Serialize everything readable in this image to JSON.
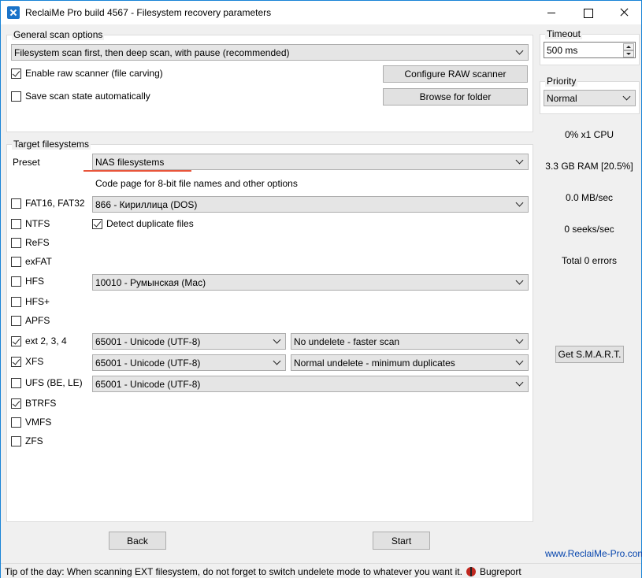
{
  "window": {
    "title": "ReclaiMe Pro build 4567 - Filesystem recovery parameters"
  },
  "general": {
    "title": "General scan options",
    "scan_mode": "Filesystem scan first, then deep scan, with pause (recommended)",
    "raw_scanner": {
      "label": "Enable raw scanner (file carving)",
      "checked": true
    },
    "save_state": {
      "label": "Save scan state automatically",
      "checked": false
    },
    "configure_raw_button": "Configure RAW scanner",
    "browse_button": "Browse for folder"
  },
  "target": {
    "title": "Target filesystems",
    "preset_label": "Preset",
    "preset_value": "NAS filesystems",
    "codepage_note": "Code page for 8-bit file names and other options",
    "detect_duplicates": {
      "label": "Detect duplicate files",
      "checked": true
    },
    "filesystems": [
      {
        "label": "FAT16, FAT32",
        "checked": false,
        "codepage": "866 - Кириллица (DOS)"
      },
      {
        "label": "NTFS",
        "checked": false
      },
      {
        "label": "ReFS",
        "checked": false
      },
      {
        "label": "exFAT",
        "checked": false
      },
      {
        "label": "HFS",
        "checked": false,
        "codepage": "10010 - Румынская (Mac)"
      },
      {
        "label": "HFS+",
        "checked": false
      },
      {
        "label": "APFS",
        "checked": false
      },
      {
        "label": "ext 2, 3, 4",
        "checked": true,
        "codepage": "65001 - Unicode (UTF-8)",
        "undelete": "No undelete - faster scan"
      },
      {
        "label": "XFS",
        "checked": true,
        "codepage": "65001 - Unicode (UTF-8)",
        "undelete": "Normal undelete - minimum duplicates"
      },
      {
        "label": "UFS (BE, LE)",
        "checked": false,
        "codepage": "65001 - Unicode (UTF-8)"
      },
      {
        "label": "BTRFS",
        "checked": true
      },
      {
        "label": "VMFS",
        "checked": false
      },
      {
        "label": "ZFS",
        "checked": false
      }
    ]
  },
  "buttons": {
    "back": "Back",
    "start": "Start"
  },
  "right_panel": {
    "timeout_label": "Timeout",
    "timeout_value": "500 ms",
    "priority_label": "Priority",
    "priority_value": "Normal",
    "cpu": "0% x1 CPU",
    "ram": "3.3 GB RAM [20.5%]",
    "speed": "0.0 MB/sec",
    "seeks": "0 seeks/sec",
    "errors": "Total 0 errors",
    "smart_button": "Get S.M.A.R.T.",
    "website": "www.ReclaiMe-Pro.com"
  },
  "status": {
    "tip": "Tip of the day: When scanning EXT filesystem, do not forget to switch undelete mode to whatever you want it.",
    "bugreport": "Bugreport"
  },
  "colors": {
    "accent": "#1883d7",
    "preset_underline": "#e8553b",
    "link": "#0645ad"
  }
}
